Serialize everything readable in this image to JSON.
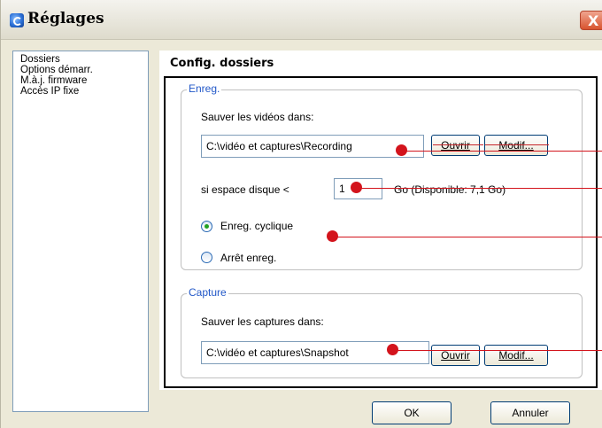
{
  "window": {
    "title": "Réglages",
    "close_label": "X"
  },
  "sidebar": {
    "items": [
      {
        "label": "Dossiers"
      },
      {
        "label": "Options démarr."
      },
      {
        "label": "M.à.j. firmware"
      },
      {
        "label": "Accès IP fixe"
      }
    ]
  },
  "panel": {
    "title": "Config. dossiers"
  },
  "recording": {
    "legend": "Enreg.",
    "save_label": "Sauver les vidéos dans:",
    "path_value": "C:\\vidéo et captures\\Recording",
    "browse_label": "Ouvrir",
    "modify_label": "Modif...",
    "disk_label": "si espace disque <",
    "disk_value": "1",
    "disk_info": "Go (Disponible: 7,1 Go)",
    "radio_cyclic_label": "Enreg. cyclique",
    "radio_stop_label": "Arrêt enreg.",
    "selected_mode": "cyclic"
  },
  "capture": {
    "legend": "Capture",
    "save_label": "Sauver les captures dans:",
    "path_value": "C:\\vidéo et captures\\Snapshot",
    "browse_label": "Ouvrir",
    "modify_label": "Modif..."
  },
  "footer": {
    "ok_label": "OK",
    "cancel_label": "Annuler"
  },
  "annotation_color": "#d3141c"
}
